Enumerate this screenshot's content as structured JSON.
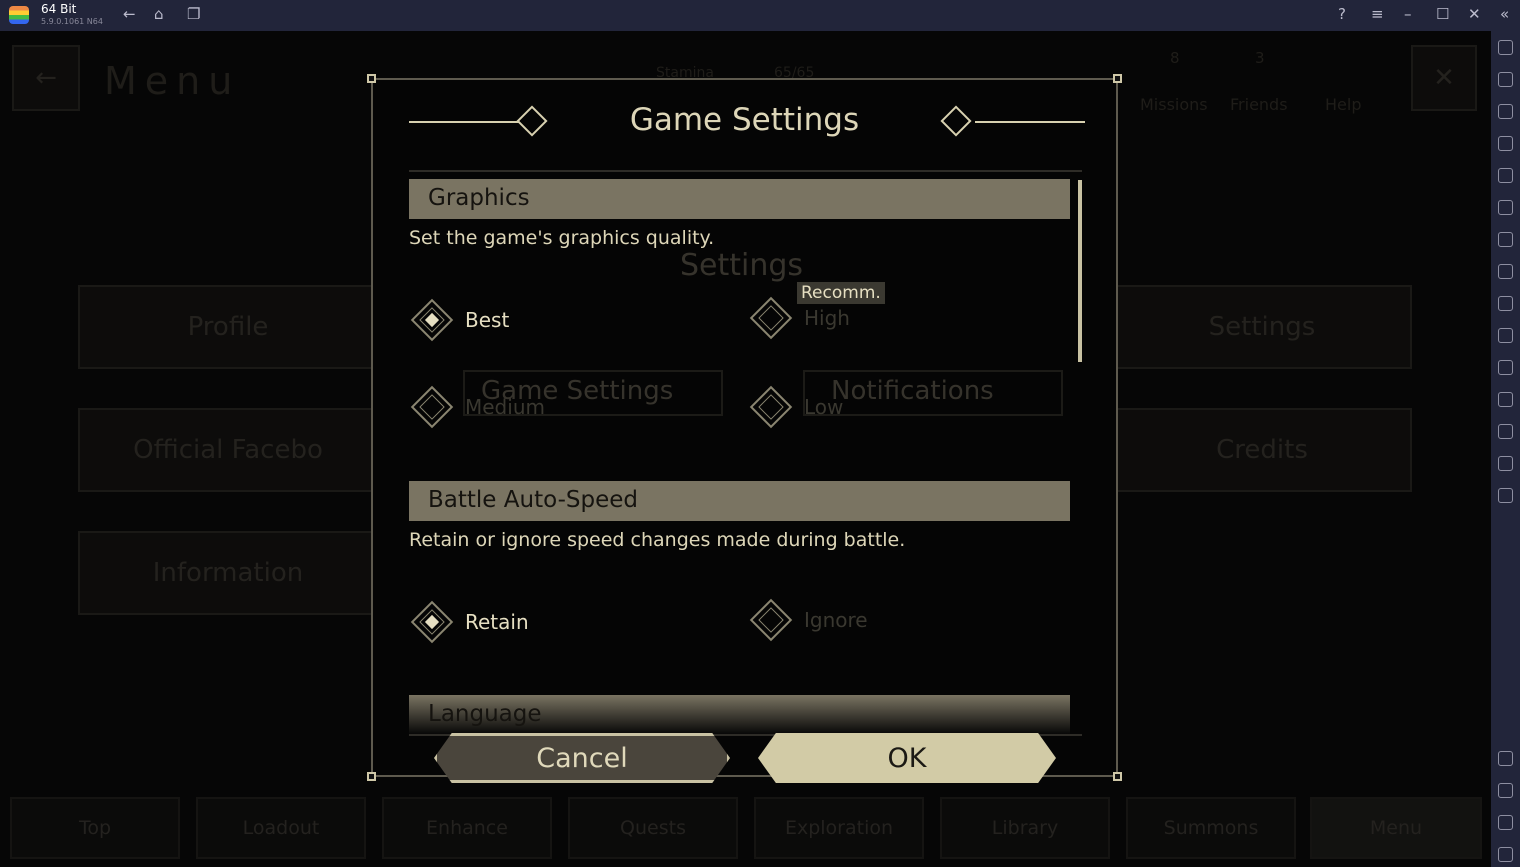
{
  "window": {
    "app_name": "64 Bit",
    "version": "5.9.0.1061 N64"
  },
  "background": {
    "menu_title": "Menu",
    "stamina_label": "Stamina",
    "stamina_value": "65/65",
    "missions": {
      "label": "Missions",
      "count": "8"
    },
    "friends": {
      "label": "Friends",
      "count": "3"
    },
    "help": "Help",
    "settings_title": "Settings",
    "buttons": [
      "Profile",
      "Settings",
      "Official Facebo",
      "Credits",
      "Information"
    ],
    "tabs": [
      "Game Settings",
      "Notifications"
    ],
    "nav": [
      "Top",
      "Loadout",
      "Enhance",
      "Quests",
      "Exploration",
      "Library",
      "Summons",
      "Menu"
    ]
  },
  "dialog": {
    "title": "Game Settings",
    "sections": [
      {
        "header": "Graphics",
        "description": "Set the game's graphics quality.",
        "options": [
          {
            "label": "Best",
            "selected": true
          },
          {
            "label": "High",
            "selected": false,
            "badge": "Recomm."
          },
          {
            "label": "Medium",
            "selected": false
          },
          {
            "label": "Low",
            "selected": false
          }
        ]
      },
      {
        "header": "Battle Auto-Speed",
        "description": "Retain or ignore speed changes made during battle.",
        "options": [
          {
            "label": "Retain",
            "selected": true
          },
          {
            "label": "Ignore",
            "selected": false
          }
        ]
      },
      {
        "header": "Language"
      }
    ],
    "cancel": "Cancel",
    "ok": "OK"
  },
  "colors": {
    "accent": "#ddd6b8",
    "section_header": "#7a7462",
    "ok_bg": "#d2cba6",
    "cancel_bg": "#4a453c"
  }
}
